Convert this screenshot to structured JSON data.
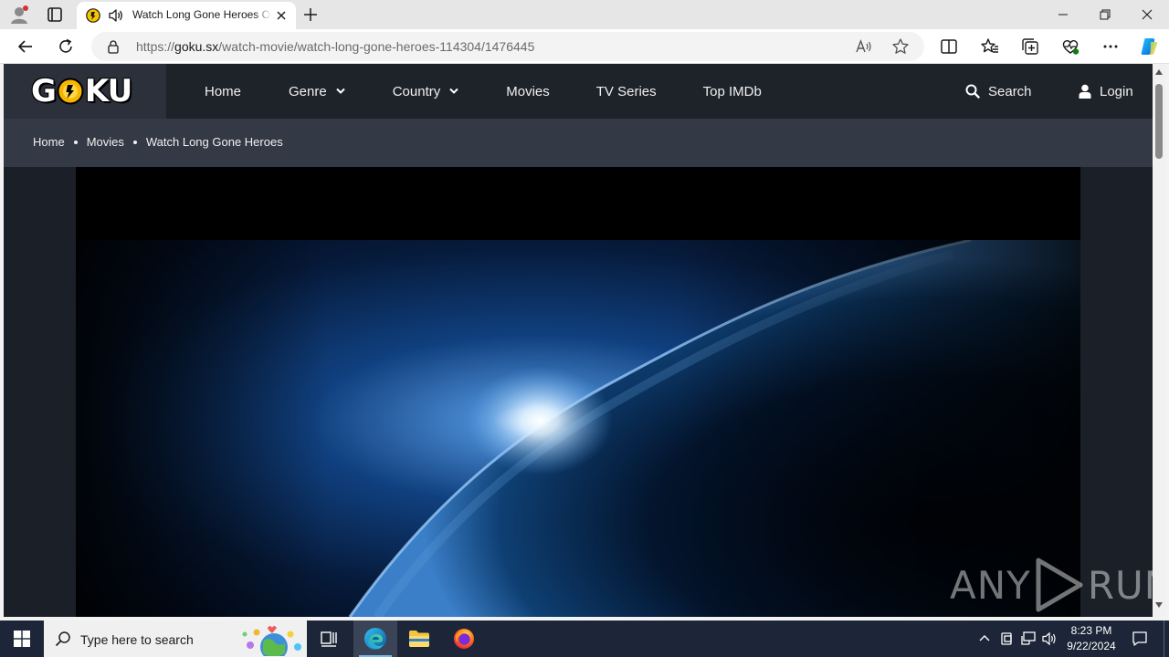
{
  "browser": {
    "tab": {
      "title": "Watch Long Gone Heroes Online",
      "audio": "speaker-icon"
    },
    "url": {
      "scheme": "https://",
      "host": "goku.sx",
      "path": "/watch-movie/watch-long-gone-heroes-114304/1476445"
    }
  },
  "site": {
    "logo": {
      "prefix": "G",
      "suffix": "KU"
    },
    "nav": [
      {
        "label": "Home",
        "dropdown": false
      },
      {
        "label": "Genre",
        "dropdown": true
      },
      {
        "label": "Country",
        "dropdown": true
      },
      {
        "label": "Movies",
        "dropdown": false
      },
      {
        "label": "TV Series",
        "dropdown": false
      },
      {
        "label": "Top IMDb",
        "dropdown": false
      }
    ],
    "search_label": "Search",
    "login_label": "Login",
    "breadcrumb": [
      "Home",
      "Movies",
      "Watch Long Gone Heroes"
    ]
  },
  "watermark": {
    "left": "ANY",
    "right": "RUN"
  },
  "taskbar": {
    "search_placeholder": "Type here to search",
    "time": "8:23 PM",
    "date": "9/22/2024"
  },
  "colors": {
    "header_bg": "#1e2229",
    "breadcrumb_bg": "#333945",
    "taskbar_bg": "#1d2638",
    "edge_blue": "#0c59a4"
  }
}
